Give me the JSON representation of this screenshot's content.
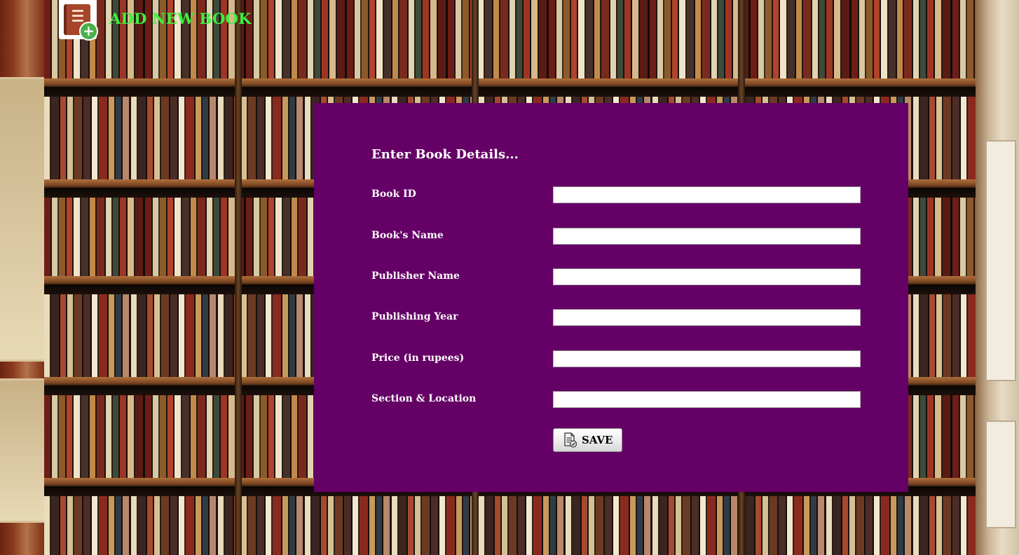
{
  "header": {
    "title": "ADD NEW BOOK",
    "icon": "add-book-icon",
    "title_color": "#3df03d"
  },
  "form": {
    "heading": "Enter Book Details...",
    "background_color": "#650066",
    "fields": [
      {
        "label": "Book ID",
        "value": "",
        "placeholder": ""
      },
      {
        "label": "Book's Name",
        "value": "",
        "placeholder": ""
      },
      {
        "label": "Publisher Name",
        "value": "",
        "placeholder": ""
      },
      {
        "label": "Publishing Year",
        "value": "",
        "placeholder": ""
      },
      {
        "label": "Price (in rupees)",
        "value": "",
        "placeholder": ""
      },
      {
        "label": "Section & Location",
        "value": "",
        "placeholder": ""
      }
    ],
    "save_button": {
      "label": "SAVE",
      "icon": "save-document-icon"
    }
  },
  "background": {
    "description_icon": "bookshelf-background"
  }
}
